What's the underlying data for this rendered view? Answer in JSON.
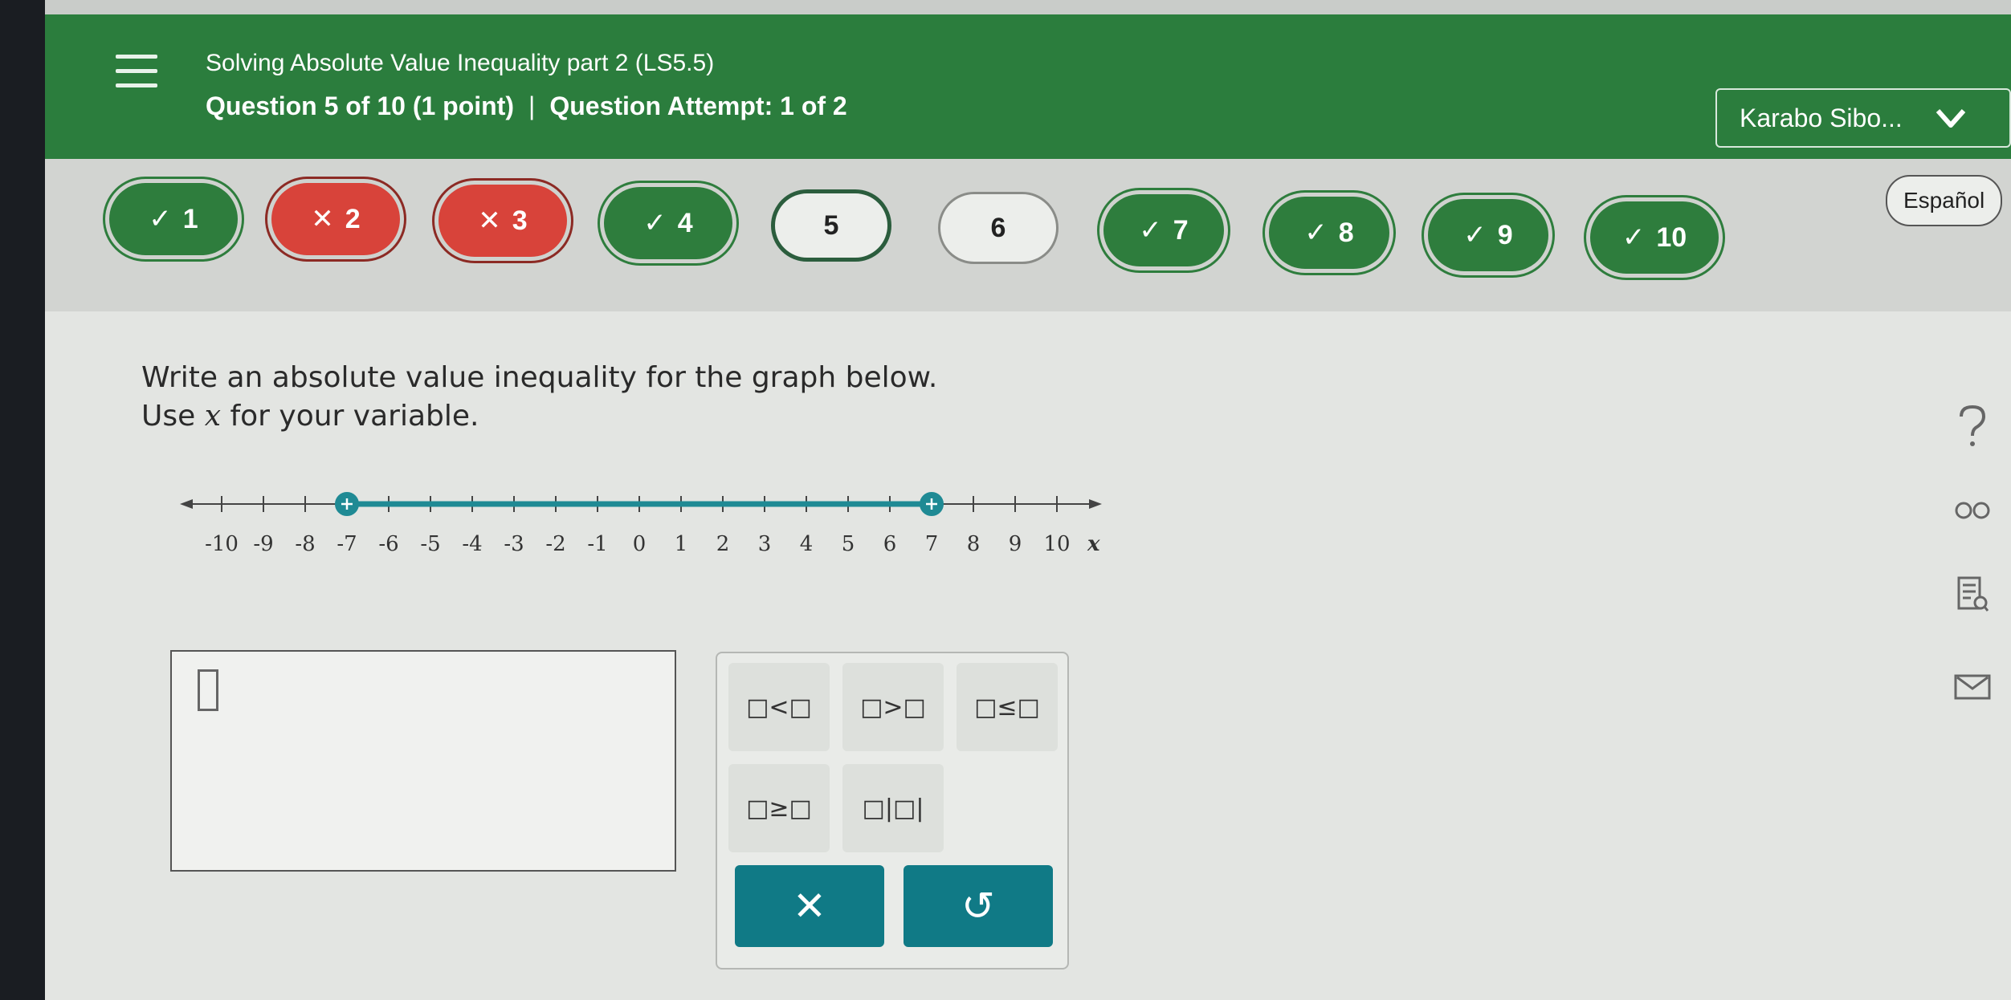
{
  "header": {
    "title": "Solving Absolute Value Inequality part 2 (LS5.5)",
    "question_label": "Question 5 of 10 (1 point)",
    "separator": "|",
    "attempt_label": "Question Attempt: 1 of 2",
    "user_name": "Karabo Sibo..."
  },
  "questions": [
    {
      "num": "1",
      "status": "correct",
      "mark": "✓"
    },
    {
      "num": "2",
      "status": "incorrect",
      "mark": "✕"
    },
    {
      "num": "3",
      "status": "incorrect",
      "mark": "✕"
    },
    {
      "num": "4",
      "status": "correct",
      "mark": "✓"
    },
    {
      "num": "5",
      "status": "current",
      "mark": ""
    },
    {
      "num": "6",
      "status": "unanswered",
      "mark": ""
    },
    {
      "num": "7",
      "status": "correct",
      "mark": "✓"
    },
    {
      "num": "8",
      "status": "correct",
      "mark": "✓"
    },
    {
      "num": "9",
      "status": "correct",
      "mark": "✓"
    },
    {
      "num": "10",
      "status": "correct",
      "mark": "✓"
    }
  ],
  "language_button": "Español",
  "prompt": {
    "line1": "Write an absolute value inequality for the graph below.",
    "line2_before": "Use ",
    "variable": "x",
    "line2_after": " for your variable."
  },
  "number_line": {
    "tick_labels": [
      "-10",
      "-9",
      "-8",
      "-7",
      "-6",
      "-5",
      "-4",
      "-3",
      "-2",
      "-1",
      "0",
      "1",
      "2",
      "3",
      "4",
      "5",
      "6",
      "7",
      "8",
      "9",
      "10"
    ],
    "axis_label": "x",
    "shaded_from": -7,
    "shaded_to": 7,
    "endpoint_style": "closed"
  },
  "keypad": {
    "keys": [
      "□<□",
      "□>□",
      "□≤□",
      "□≥□",
      "□|□|"
    ],
    "clear_symbol": "✕",
    "undo_symbol": "↺"
  },
  "colors": {
    "header": "#2b7d3d",
    "correct": "#2e7d3d",
    "incorrect": "#d8433a",
    "graph": "#1f8a94",
    "action": "#107a86"
  }
}
